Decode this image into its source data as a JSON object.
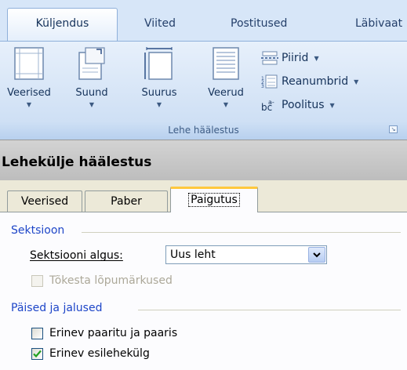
{
  "ribbon": {
    "tabs": [
      {
        "label": "Küljendus",
        "active": true
      },
      {
        "label": "Viited",
        "active": false
      },
      {
        "label": "Postitused",
        "active": false
      },
      {
        "label": "Läbivaat",
        "active": false
      }
    ],
    "buttons": {
      "margins": "Veerised",
      "orientation": "Suund",
      "size": "Suurus",
      "columns": "Veerud",
      "breaks": "Piirid",
      "line_numbers": "Reanumbrid",
      "hyphenation": "Poolitus"
    },
    "group_label": "Lehe häälestus"
  },
  "dialog": {
    "title": "Lehekülje häälestus",
    "tabs": [
      {
        "label": "Veerised",
        "active": false
      },
      {
        "label": "Paber",
        "active": false
      },
      {
        "label": "Paigutus",
        "active": true
      }
    ],
    "section_heading": "Sektsioon",
    "section_start": {
      "label": "Sektsiooni algus:",
      "value": "Uus leht"
    },
    "suppress_endnotes": {
      "label": "Tõkesta lõpumärkused",
      "checked": false,
      "enabled": false
    },
    "headers_heading": "Päised ja jalused",
    "odd_even": {
      "label": "Erinev paaritu ja paaris",
      "checked": false
    },
    "first_page": {
      "label": "Erinev esilehekülg",
      "checked": true
    }
  },
  "colors": {
    "ribbon_bg": "#bfd6f1",
    "section_heading": "#1e46c8",
    "check_green": "#21a121",
    "active_tab_accent": "#ffc83c"
  }
}
